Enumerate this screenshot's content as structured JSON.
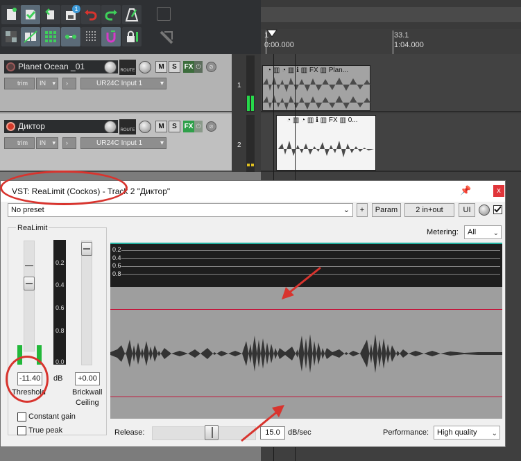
{
  "toolbar": {
    "row1": [
      "new-project-icon",
      "save-project-icon",
      "project-settings-icon",
      "new-track-icon",
      "undo-icon",
      "redo-icon",
      "metronome-icon"
    ],
    "row2": [
      "snap-grid-icon",
      "ripple-edit-icon",
      "grid-icon",
      "item-edit-icon",
      "dotted-grid-icon",
      "loop-icon",
      "lock-icon"
    ],
    "badge": "1"
  },
  "timeline": {
    "marker_small": "1",
    "marker_label": "33.1",
    "time_start": "0:00.000",
    "time_label": "1:04.000"
  },
  "tracks": [
    {
      "number": "1",
      "name": "Planet Ocean _01",
      "input_label": "trim",
      "in_label": "IN",
      "input_name": "UR24C Input 1",
      "route": "ROUTE",
      "m": "M",
      "s": "S",
      "fx": "FX",
      "item_name": "Plan...",
      "armed": false
    },
    {
      "number": "2",
      "name": "Диктор",
      "input_label": "trim",
      "in_label": "IN",
      "input_name": "UR24C Input 1",
      "route": "ROUTE",
      "m": "M",
      "s": "S",
      "fx": "FX",
      "item_name": "0...",
      "armed": true
    }
  ],
  "fxwindow": {
    "title": "VST: ReaLimit (Cockos) - Track 2 \"Диктор\"",
    "close": "x",
    "preset": "No preset",
    "plus": "+",
    "param": "Param",
    "io": "2 in+out",
    "ui": "UI",
    "metering_label": "Metering:",
    "metering_value": "All",
    "panel_title": "ReaLimit",
    "threshold_value": "-11.40",
    "threshold_label": "Threshold",
    "db_label": "dB",
    "ceiling_value": "+0.00",
    "ceiling_label1": "Brickwall",
    "ceiling_label2": "Ceiling",
    "meter_scale": [
      "0.2",
      "0.4",
      "0.6",
      "0.8",
      "0.0"
    ],
    "display_scale": [
      "0.2",
      "0.4",
      "0.6",
      "0.8"
    ],
    "constant_gain": "Constant gain",
    "true_peak": "True peak",
    "release_label": "Release:",
    "release_value": "15.0",
    "release_unit": "dB/sec",
    "performance_label": "Performance:",
    "performance_value": "High quality"
  },
  "colors": {
    "annotation_red": "#d8342e",
    "threshold_line": "#c4143a",
    "meter_green": "#22b83a",
    "close_red": "#e0353a"
  }
}
